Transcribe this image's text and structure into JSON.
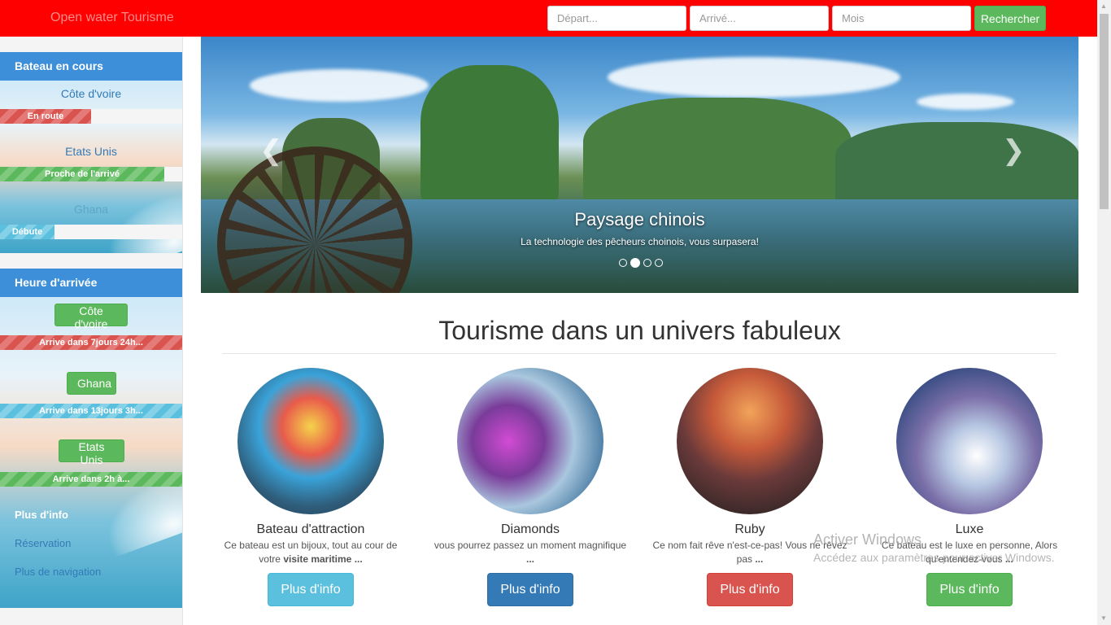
{
  "navbar": {
    "brand": "Open water Tourisme",
    "depart_placeholder": "Départ...",
    "arrive_placeholder": "Arrivé...",
    "month_placeholder": "Mois",
    "search_label": "Rechercher"
  },
  "sidebar": {
    "current_boats_title": "Bateau en cours",
    "boats": [
      {
        "country": "Côte d'voire",
        "status": "En route",
        "progress_percent": 50,
        "color": "#d9534f"
      },
      {
        "country": "Etats Unis",
        "status": "Proche de l'arrivé",
        "progress_percent": 90,
        "color": "#5cb85c"
      },
      {
        "country": "Ghana",
        "status": "Débute",
        "progress_percent": 30,
        "color": "#5bc0de"
      }
    ],
    "arrival_title": "Heure d'arrivée",
    "arrivals": [
      {
        "country": "Côte d'voire",
        "eta": "Arrive dans 7jours 24h..."
      },
      {
        "country": "Ghana",
        "eta": "Arrive dans 13jours 3h..."
      },
      {
        "country": "Etats Unis",
        "eta": "Arrive dans 2h à..."
      }
    ],
    "more_info": "Plus d'info",
    "links": [
      "Réservation",
      "Plus de navigation"
    ]
  },
  "carousel": {
    "title": "Paysage chinois",
    "text": "La technologie des pêcheurs choinois, vous surpasera!",
    "slides": 4,
    "active_slide": 2,
    "prev_icon": "chevron-left-icon",
    "next_icon": "chevron-right-icon"
  },
  "main": {
    "heading": "Tourisme dans un univers fabuleux",
    "cards": [
      {
        "title": "Bateau d'attraction",
        "text": "Ce bateau est un bijoux, tout au cour de votre",
        "text_bold": "visite maritime ...",
        "button": "Plus d'info",
        "color": "#5bc0de"
      },
      {
        "title": "Diamonds",
        "text": "vous pourrez passez un moment magnifique",
        "text_bold": "...",
        "button": "Plus d'info",
        "color": "#337ab7"
      },
      {
        "title": "Ruby",
        "text": "Ce nom fait rêve n'est-ce-pas! Vous ne rêvez pas",
        "text_bold": "...",
        "button": "Plus d'info",
        "color": "#d9534f"
      },
      {
        "title": "Luxe",
        "text": "Ce bateau est le luxe en personne, Alors qu'entendez-vous",
        "text_bold": "...",
        "button": "Plus d'info",
        "color": "#5cb85c"
      }
    ]
  },
  "watermark": {
    "title": "Activer Windows",
    "text": "Accédez aux paramètres pour activer Windows."
  }
}
